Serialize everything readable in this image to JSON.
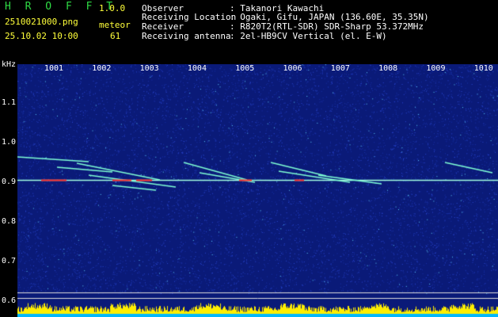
{
  "app": {
    "name": "H R O F F T",
    "version": "1.0.0"
  },
  "file": {
    "name": "2510021000.png",
    "datetime": "25.10.02 10:00"
  },
  "meteor": {
    "label": "meteor",
    "count": "61"
  },
  "meta": [
    {
      "key": "Observer",
      "value": ": Takanori Kawachi"
    },
    {
      "key": "Receiving Location",
      "value": ": Ogaki, Gifu, JAPAN (136.60E, 35.35N)"
    },
    {
      "key": "Receiver",
      "value": ": R820T2(RTL-SDR) SDR-Sharp 53.372MHz"
    },
    {
      "key": "Receiving antenna",
      "value": ": 2el-HB9CV Vertical (el. E-W)"
    }
  ],
  "chart_data": {
    "type": "heatmap",
    "ylabel": "kHz",
    "y_ticks": [
      "1.1",
      "1.0",
      "0.9",
      "0.8",
      "0.7",
      "0.6"
    ],
    "x_ticks": [
      "1001",
      "1002",
      "1003",
      "1004",
      "1005",
      "1006",
      "1007",
      "1008",
      "1009",
      "1010"
    ],
    "ylim": [
      0.58,
      1.2
    ],
    "carrier_khz": 0.905,
    "colors": {
      "background": "#0a1a78",
      "noise": "#2b48d4",
      "echo": "#7fffd4",
      "hot": "#ff3030",
      "strip_bar": "#ffee00",
      "strip_bg": "#00b8ff"
    }
  }
}
